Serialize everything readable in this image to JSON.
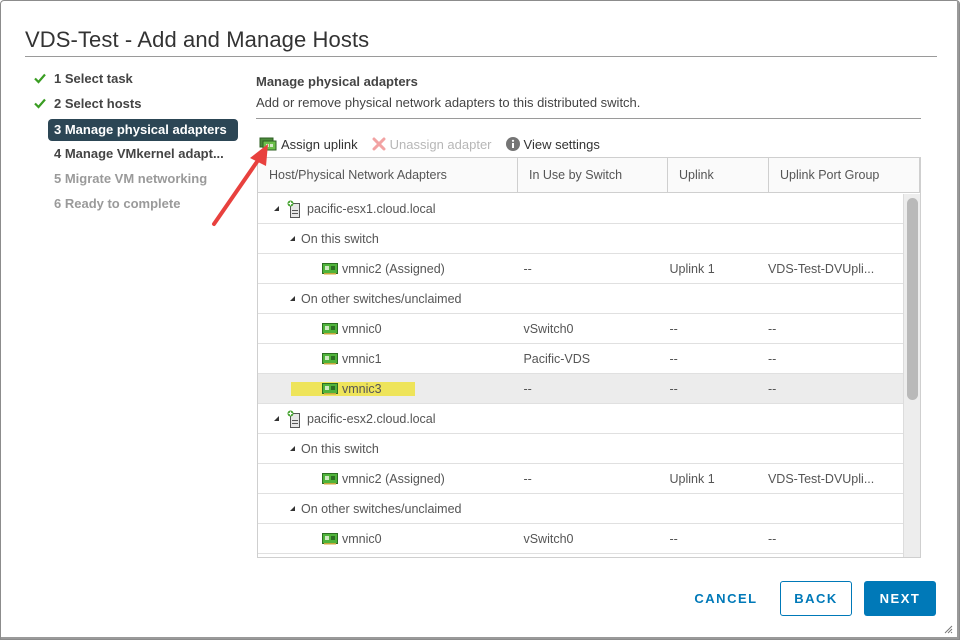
{
  "dialog": {
    "title": "VDS-Test - Add and Manage Hosts"
  },
  "steps": [
    {
      "label": "1 Select task",
      "state": "done"
    },
    {
      "label": "2 Select hosts",
      "state": "done"
    },
    {
      "label": "3 Manage physical adapters",
      "state": "active"
    },
    {
      "label": "4 Manage VMkernel adapt...",
      "state": "normal"
    },
    {
      "label": "5 Migrate VM networking",
      "state": "disabled"
    },
    {
      "label": "6 Ready to complete",
      "state": "disabled"
    }
  ],
  "main": {
    "title": "Manage physical adapters",
    "description": "Add or remove physical network adapters to this distributed switch."
  },
  "toolbar": {
    "assign_uplink": {
      "label": "Assign uplink",
      "icon": "assign-uplink-icon",
      "enabled": true
    },
    "unassign_adapter": {
      "label": "Unassign adapter",
      "icon": "red-x-icon",
      "enabled": false
    },
    "view_settings": {
      "label": "View settings",
      "icon": "info-icon",
      "enabled": true
    }
  },
  "grid": {
    "columns": [
      "Host/Physical Network Adapters",
      "In Use by Switch",
      "Uplink",
      "Uplink Port Group"
    ],
    "rows": [
      {
        "type": "host",
        "name": "pacific-esx1.cloud.local",
        "in_use": "",
        "uplink": "",
        "port_group": ""
      },
      {
        "type": "group",
        "name": "On this switch",
        "in_use": "",
        "uplink": "",
        "port_group": ""
      },
      {
        "type": "nic",
        "name": "vmnic2 (Assigned)",
        "in_use": "--",
        "uplink": "Uplink 1",
        "port_group": "VDS-Test-DVUpli..."
      },
      {
        "type": "group",
        "name": "On other switches/unclaimed",
        "in_use": "",
        "uplink": "",
        "port_group": ""
      },
      {
        "type": "nic",
        "name": "vmnic0",
        "in_use": "vSwitch0",
        "uplink": "--",
        "port_group": "--"
      },
      {
        "type": "nic",
        "name": "vmnic1",
        "in_use": "Pacific-VDS",
        "uplink": "--",
        "port_group": "--"
      },
      {
        "type": "nic",
        "name": "vmnic3",
        "in_use": "--",
        "uplink": "--",
        "port_group": "--",
        "selected": true,
        "highlighted": true
      },
      {
        "type": "host",
        "name": "pacific-esx2.cloud.local",
        "in_use": "",
        "uplink": "",
        "port_group": ""
      },
      {
        "type": "group",
        "name": "On this switch",
        "in_use": "",
        "uplink": "",
        "port_group": ""
      },
      {
        "type": "nic",
        "name": "vmnic2 (Assigned)",
        "in_use": "--",
        "uplink": "Uplink 1",
        "port_group": "VDS-Test-DVUpli..."
      },
      {
        "type": "group",
        "name": "On other switches/unclaimed",
        "in_use": "",
        "uplink": "",
        "port_group": ""
      },
      {
        "type": "nic",
        "name": "vmnic0",
        "in_use": "vSwitch0",
        "uplink": "--",
        "port_group": "--"
      },
      {
        "type": "nic",
        "name": "",
        "in_use": "",
        "uplink": "",
        "port_group": ""
      }
    ]
  },
  "footer": {
    "cancel": "CANCEL",
    "back": "BACK",
    "next": "NEXT"
  },
  "colors": {
    "accent": "#0079b8",
    "active_step_bg": "#2c4655",
    "check_green": "#3a9d23",
    "highlight_yellow": "#eee45a",
    "annotation_red": "#e8413e"
  }
}
